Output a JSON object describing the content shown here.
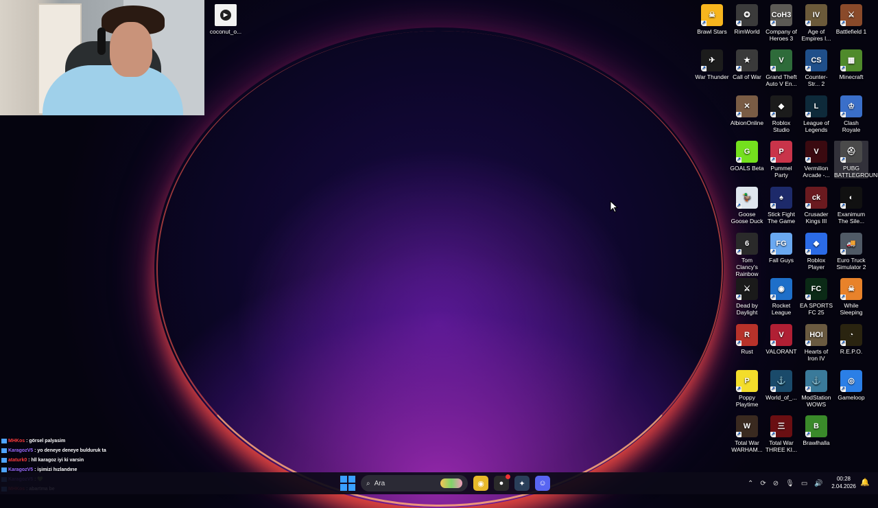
{
  "desktop_file": {
    "label": "coconut_o...",
    "icon": "video-file-icon"
  },
  "icons": [
    {
      "label": "Brawl Stars",
      "color": "#f7b51e",
      "glyph": "☠",
      "name": "brawl-stars"
    },
    {
      "label": "RimWorld",
      "color": "#3b3b3b",
      "glyph": "✪",
      "name": "rimworld"
    },
    {
      "label": "Company of Heroes 3",
      "color": "#5c5a55",
      "glyph": "CoH3",
      "name": "company-of-heroes-3"
    },
    {
      "label": "Age of Empires I...",
      "color": "#6b5a3a",
      "glyph": "IV",
      "name": "age-of-empires"
    },
    {
      "label": "Battlefield 1",
      "color": "#8a4a2a",
      "glyph": "⚔",
      "name": "battlefield-1"
    },
    {
      "label": "War Thunder",
      "color": "#1c1c1c",
      "glyph": "✈",
      "name": "war-thunder"
    },
    {
      "label": "Call of War",
      "color": "#3a3a3a",
      "glyph": "★",
      "name": "call-of-war"
    },
    {
      "label": "Grand Theft Auto V En...",
      "color": "#2e6b3a",
      "glyph": "V",
      "name": "gta-v"
    },
    {
      "label": "Counter-Str... 2",
      "color": "#1f4f8a",
      "glyph": "CS",
      "name": "counter-strike-2"
    },
    {
      "label": "Minecraft",
      "color": "#4f8a2b",
      "glyph": "▦",
      "name": "minecraft"
    },
    {
      "label": "AlbionOnline",
      "color": "#7a5c45",
      "glyph": "✕",
      "name": "albion-online"
    },
    {
      "label": "Roblox Studio",
      "color": "#1b1b1b",
      "glyph": "◆",
      "name": "roblox-studio"
    },
    {
      "label": "League of Legends",
      "color": "#0e2a3a",
      "glyph": "L",
      "name": "league-of-legends"
    },
    {
      "label": "Clash Royale",
      "color": "#3a6fc9",
      "glyph": "♔",
      "name": "clash-royale"
    },
    {
      "label": "GOALS Beta",
      "color": "#74e01e",
      "glyph": "G",
      "name": "goals-beta"
    },
    {
      "label": "Pummel Party",
      "color": "#c9344a",
      "glyph": "P",
      "name": "pummel-party"
    },
    {
      "label": "Vermilion Arcade -...",
      "color": "#3a0a10",
      "glyph": "V",
      "name": "vermilion-arcade"
    },
    {
      "label": "PUBG BATTLEGROUNDS",
      "color": "#4a4a4a",
      "glyph": "⛑",
      "name": "pubg",
      "selected": true
    },
    {
      "label": "Goose Goose Duck",
      "color": "#dfe6ee",
      "glyph": "🦆",
      "name": "goose-goose-duck"
    },
    {
      "label": "Stick Fight The Game",
      "color": "#1d2a6a",
      "glyph": "♠",
      "name": "stick-fight"
    },
    {
      "label": "Crusader Kings III",
      "color": "#6a1a1f",
      "glyph": "ck",
      "name": "crusader-kings"
    },
    {
      "label": "Exanimum The Sile...",
      "color": "#111111",
      "glyph": "◐",
      "name": "exanimum"
    },
    {
      "label": "Tom Clancy's Rainbow Si...",
      "color": "#2a2a2a",
      "glyph": "6",
      "name": "rainbow-six"
    },
    {
      "label": "Fall Guys",
      "color": "#6aa8f0",
      "glyph": "FG",
      "name": "fall-guys"
    },
    {
      "label": "Roblox Player",
      "color": "#2b6be6",
      "glyph": "◆",
      "name": "roblox-player"
    },
    {
      "label": "Euro Truck Simulator 2",
      "color": "#505a66",
      "glyph": "🚚",
      "name": "euro-truck"
    },
    {
      "label": "Dead by Daylight",
      "color": "#1a1a1a",
      "glyph": "⚔",
      "name": "dead-by-daylight"
    },
    {
      "label": "Rocket League",
      "color": "#1e6fc9",
      "glyph": "◉",
      "name": "rocket-league"
    },
    {
      "label": "EA SPORTS FC 25",
      "color": "#0b2a16",
      "glyph": "FC",
      "name": "ea-fc-25"
    },
    {
      "label": "While Sleeping",
      "color": "#e8822a",
      "glyph": "☠",
      "name": "while-sleeping"
    },
    {
      "label": "Rust",
      "color": "#b8322a",
      "glyph": "R",
      "name": "rust"
    },
    {
      "label": "VALORANT",
      "color": "#b01f34",
      "glyph": "V",
      "name": "valorant"
    },
    {
      "label": "Hearts of Iron IV",
      "color": "#6a5a40",
      "glyph": "HOI",
      "name": "hearts-of-iron"
    },
    {
      "label": "R.E.P.O.",
      "color": "#2a2410",
      "glyph": "◔",
      "name": "repo"
    },
    {
      "label": "Poppy Playtime",
      "color": "#f3dd2b",
      "glyph": "P",
      "name": "poppy-playtime"
    },
    {
      "label": "World_of_...",
      "color": "#1a4a6a",
      "glyph": "⚓",
      "name": "world-of-warships"
    },
    {
      "label": "ModStation WOWS",
      "color": "#3a7a9a",
      "glyph": "⚓",
      "name": "modstation-wows"
    },
    {
      "label": "Gameloop",
      "color": "#2b7fe6",
      "glyph": "◎",
      "name": "gameloop"
    },
    {
      "label": "Total War WARHAM...",
      "color": "#3a2a20",
      "glyph": "W",
      "name": "total-war-warhammer"
    },
    {
      "label": "Total War THREE KI...",
      "color": "#6a0f12",
      "glyph": "三",
      "name": "total-war-three-kingdoms"
    },
    {
      "label": "Brawlhalla",
      "color": "#3a8a2a",
      "glyph": "B",
      "name": "brawlhalla"
    }
  ],
  "chat": [
    {
      "user": "MHKos",
      "user_color": "red",
      "message": ": görsel palyasim"
    },
    {
      "user": "KaragozV5",
      "user_color": "purple",
      "message": ": yo deneye deneye bulduruk ta"
    },
    {
      "user": "ataturk0",
      "user_color": "red",
      "message": ": hll karagoz iyi ki varsin"
    },
    {
      "user": "KaragozV5",
      "user_color": "purple",
      "message": ": işimizi hızlandırıe"
    },
    {
      "user": "KaragozV5",
      "user_color": "purple",
      "message": ": 💚"
    },
    {
      "user": "MHKos",
      "user_color": "red",
      "message": ": abartma be"
    }
  ],
  "taskbar": {
    "search_placeholder": "Ara",
    "apps": [
      {
        "name": "chrome",
        "color": "#e8b92a",
        "glyph": "◉"
      },
      {
        "name": "obs",
        "color": "#2a2a2a",
        "glyph": "●"
      },
      {
        "name": "app-3",
        "color": "#2a3f5a",
        "glyph": "✦"
      },
      {
        "name": "discord",
        "color": "#5865f2",
        "glyph": "☺"
      }
    ]
  },
  "tray": {
    "time": "00:28",
    "date": "2.04.2026"
  }
}
